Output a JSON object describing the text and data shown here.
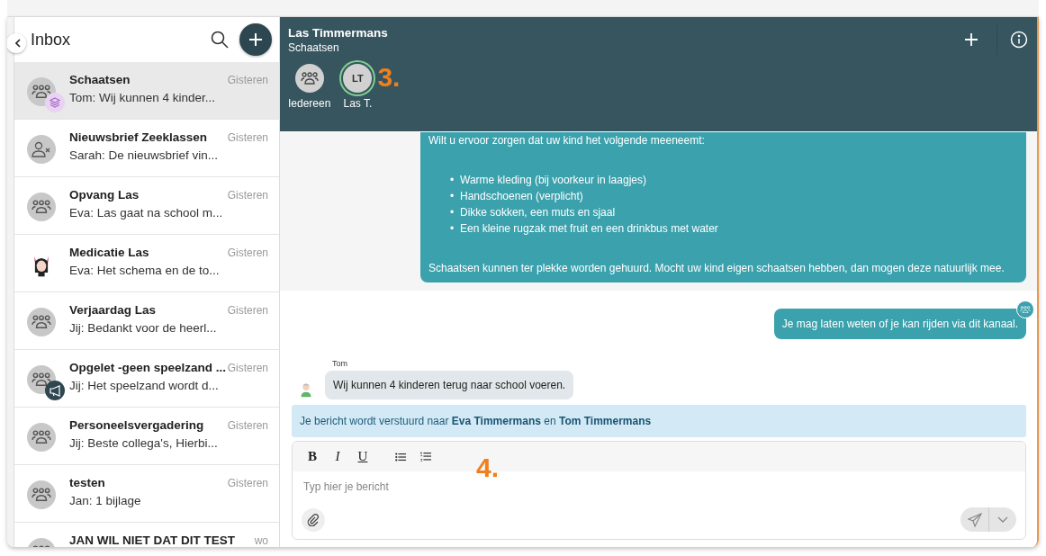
{
  "sidebar": {
    "title": "Inbox",
    "conversations": [
      {
        "title": "Schaatsen",
        "preview": "Tom: Wij kunnen 4 kinder...",
        "time": "Gisteren",
        "avatar": {
          "kind": "group"
        },
        "badge": {
          "kind": "layers"
        },
        "selected": true
      },
      {
        "title": "Nieuwsbrief Zeeklassen",
        "preview": "Sarah: De nieuwsbrief vin...",
        "time": "Gisteren",
        "avatar": {
          "kind": "person-removed"
        },
        "selected": false
      },
      {
        "title": "Opvang Las",
        "preview": "Eva: Las gaat na school m...",
        "time": "Gisteren",
        "avatar": {
          "kind": "group"
        },
        "selected": false
      },
      {
        "title": "Medicatie Las",
        "preview": "Eva: Het schema en de to...",
        "time": "Gisteren",
        "avatar": {
          "kind": "cartoon"
        },
        "selected": false
      },
      {
        "title": "Verjaardag Las",
        "preview": "Jij: Bedankt voor de heerl...",
        "time": "Gisteren",
        "avatar": {
          "kind": "group"
        },
        "selected": false
      },
      {
        "title": "Opgelet -geen speelzand ...",
        "preview": "Jij: Het speelzand wordt d...",
        "time": "Gisteren",
        "avatar": {
          "kind": "group"
        },
        "badge": {
          "kind": "megaphone"
        },
        "selected": false
      },
      {
        "title": "Personeelsvergadering",
        "preview": "Jij: Beste collega's, Hierbi...",
        "time": "Gisteren",
        "avatar": {
          "kind": "group"
        },
        "selected": false
      },
      {
        "title": "testen",
        "preview": "Jan: 1 bijlage",
        "time": "Gisteren",
        "avatar": {
          "kind": "group"
        },
        "selected": false
      },
      {
        "title": "JAN WIL NIET DAT DIT TEST",
        "time": "wo",
        "avatar": {
          "kind": "group"
        },
        "selected": false
      }
    ]
  },
  "chat": {
    "title": "Las Timmermans",
    "subtitle": "Schaatsen",
    "participants": [
      {
        "label": "Iedereen",
        "kind": "group",
        "selected": false
      },
      {
        "label": "Las T.",
        "initials": "LT",
        "kind": "initials",
        "selected": true
      }
    ],
    "header_annotation": "3.",
    "messages": [
      {
        "kind": "outgoing",
        "intro": "Wilt u ervoor zorgen dat uw kind het volgende meeneemt:",
        "bullets": [
          {
            "marker": "•",
            "text": "Warme kleding (bij voorkeur in laagjes)"
          },
          {
            "marker": "•",
            "text": "Handschoenen (verplicht)"
          },
          {
            "marker": "•",
            "text": "Dikke sokken,  een muts en sjaal"
          },
          {
            "marker": "•",
            "text": "Een kleine rugzak met fruit en een drinkbus met water"
          }
        ],
        "outro": "Schaatsen kunnen ter plekke worden gehuurd. Mocht uw kind eigen schaatsen hebben, dan mogen deze natuurlijk mee."
      },
      {
        "kind": "outgoing",
        "text": "Je mag laten weten of je kan rijden via dit kanaal.",
        "group_marker": true
      },
      {
        "kind": "incoming",
        "sender": "Tom",
        "text": "Wij kunnen 4 kinderen terug naar school voeren."
      }
    ],
    "notice": "Je bericht wordt verstuurd naar **Eva Timmermans** en **Tom Timmermans**",
    "composer": {
      "tools": [
        {
          "kind": "bold",
          "label": "B"
        },
        {
          "kind": "italic",
          "label": "I"
        },
        {
          "kind": "underline",
          "label": "U"
        },
        {
          "kind": "bullets"
        },
        {
          "kind": "numbered"
        }
      ],
      "annotation": "4.",
      "placeholder": "Typ hier je bericht"
    }
  }
}
